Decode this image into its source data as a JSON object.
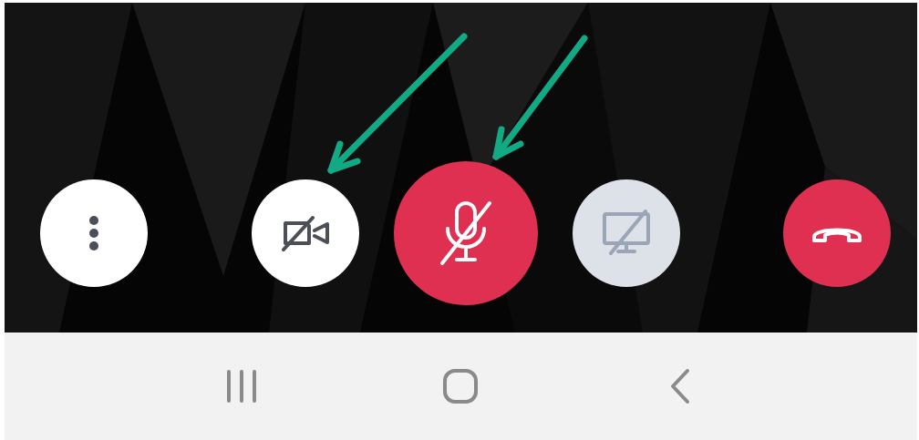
{
  "call_controls": [
    {
      "kind": "more",
      "highlighted": false
    },
    {
      "kind": "camera",
      "on": false,
      "highlighted": true
    },
    {
      "kind": "microphone",
      "on": false,
      "highlighted": true
    },
    {
      "kind": "screen_share",
      "disabled": true,
      "highlighted": false
    },
    {
      "kind": "hang_up",
      "highlighted": false
    }
  ],
  "nav_bar": [
    {
      "kind": "recents"
    },
    {
      "kind": "home"
    },
    {
      "kind": "back"
    }
  ]
}
